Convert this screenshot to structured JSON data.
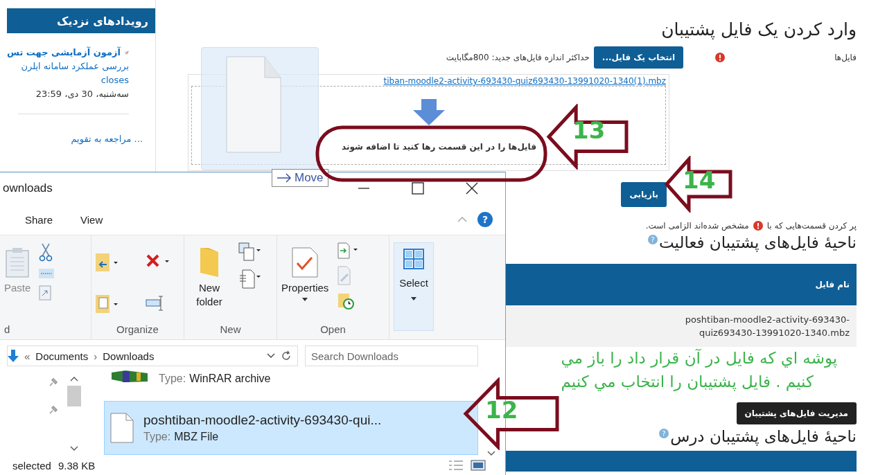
{
  "sidebar": {
    "title": "رویدادهای نزدیک",
    "event_lines": [
      "آزمون آزمایشی جهت تس",
      "بررسی عملکرد سامانه ایلرن",
      "closes",
      "سه‌شنبه، 30 دی، 23:59"
    ],
    "calendar_link": "... مراجعه به تقویم"
  },
  "import": {
    "title": "وارد کردن یک فایل پشتیبان",
    "files_label": "فایل‌ها",
    "choose_button": "انتخاب یک فایل...",
    "max_size": "حداکثر اندازه فایل‌های جدید: 800مگابایت",
    "uploaded_link": "tiban-moodle2-activity-693430-quiz693430-13991020-1340(1).mbz",
    "drop_hint": "فایل‌ها را در این قسمت رها کنید تا اضافه شوند",
    "restore_button": "بازیابی",
    "required_before": "پر کردن قسمت‌هایی که با",
    "required_after": "مشخص شده‌اند الزامی است."
  },
  "activity_area": {
    "heading": "ناحیهٔ فایل‌های پشتیبان فعالیت",
    "help": "?",
    "column": "نام فایل",
    "rows": [
      "poshtiban-moodle2-activity-693430-quiz693430-13991020-1340.mbz"
    ]
  },
  "course_area": {
    "manage_button": "مدیریت فایل‌های پشتیبان",
    "heading": "ناحیهٔ فایل‌های پشتیبان درس",
    "help": "?"
  },
  "drag": {
    "tooltip": "Move"
  },
  "explorer": {
    "title": "ownloads",
    "share_tab": "Share",
    "view_tab": "View",
    "help": "?",
    "path_prefix": "«",
    "path_separator": "›",
    "paste": "Paste",
    "clipboard_group": "d",
    "organize_group": "Organize",
    "new_folder": "New folder",
    "new_group": "New",
    "properties": "Properties",
    "open_group": "Open",
    "select": "Select",
    "path_parent": "Documents",
    "path_current": "Downloads",
    "search_placeholder": "Search Downloads",
    "files": [
      {
        "kind": "archive",
        "type_label": "Type:",
        "type": "WinRAR archive",
        "selected": false
      },
      {
        "kind": "file",
        "name": "poshtiban-moodle2-activity-693430-qui...",
        "type_label": "Type:",
        "type": "MBZ File",
        "selected": true
      }
    ],
    "status_selected": "selected",
    "status_size": "9.38 KB"
  },
  "annotations": {
    "steps": [
      "13",
      "14",
      "12"
    ],
    "note_lines": [
      "پوشه اي كه فايل در آن قرار داد را باز مي",
      "كنيم . فايل پشتيبان را انتخاب مي كنيم"
    ]
  }
}
